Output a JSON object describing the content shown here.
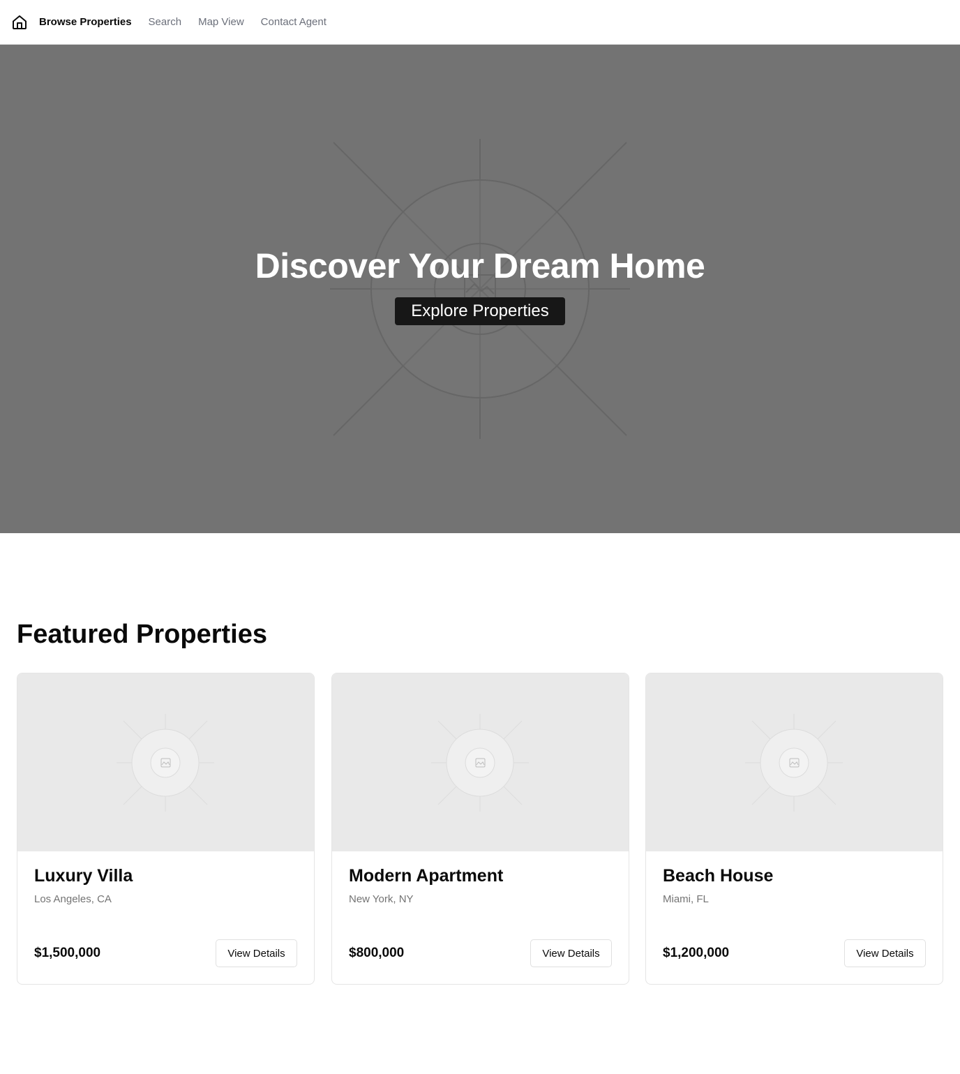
{
  "nav": {
    "home_icon": "home-icon",
    "items": [
      {
        "label": "Browse Properties",
        "active": true
      },
      {
        "label": "Search",
        "active": false
      },
      {
        "label": "Map View",
        "active": false
      },
      {
        "label": "Contact Agent",
        "active": false
      }
    ]
  },
  "hero": {
    "title": "Discover Your Dream Home",
    "cta_label": "Explore Properties",
    "background_color": "#737373",
    "image_icon": "image-placeholder-icon"
  },
  "featured": {
    "title": "Featured Properties",
    "properties": [
      {
        "name": "Luxury Villa",
        "location": "Los Angeles, CA",
        "price": "$1,500,000",
        "button_label": "View Details"
      },
      {
        "name": "Modern Apartment",
        "location": "New York, NY",
        "price": "$800,000",
        "button_label": "View Details"
      },
      {
        "name": "Beach House",
        "location": "Miami, FL",
        "price": "$1,200,000",
        "button_label": "View Details"
      }
    ]
  }
}
